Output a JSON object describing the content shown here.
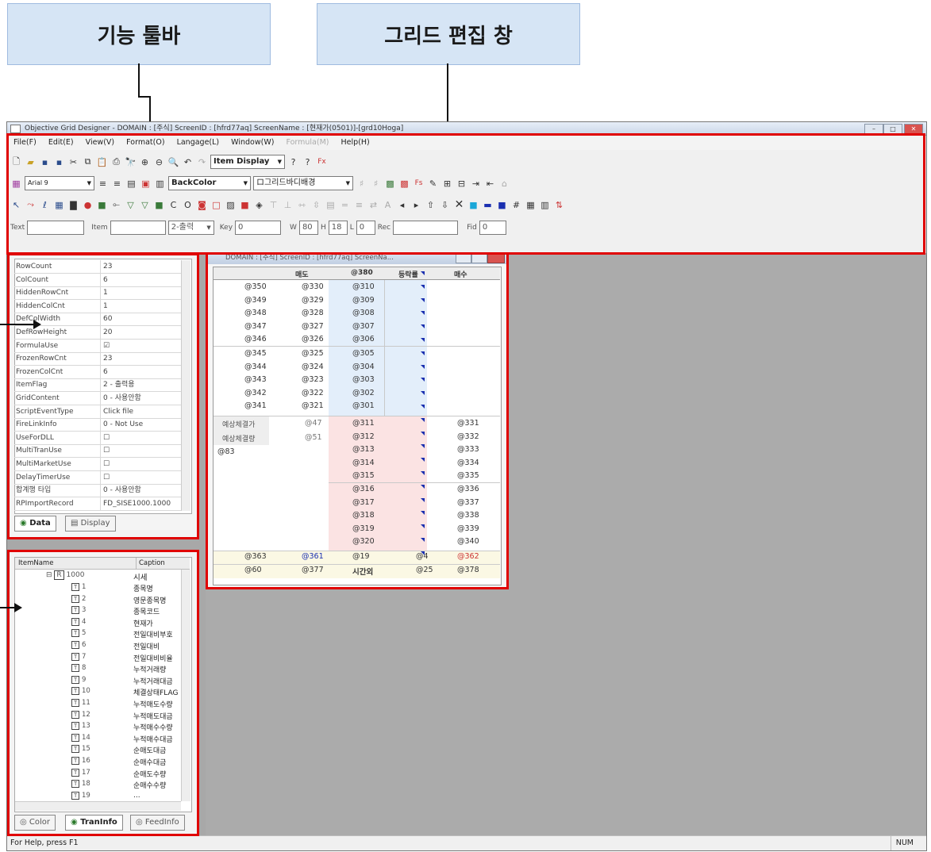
{
  "callouts": {
    "toolbar": "기능 툴바",
    "grid_edit": "그리드 편집 창"
  },
  "app": {
    "title": "Objective Grid Designer - DOMAIN : [주식]  ScreenID : [hfrd77aq]  ScreenName : [현재가(0501)]-[grd10Hoga]",
    "menu": [
      "File(F)",
      "Edit(E)",
      "View(V)",
      "Format(O)",
      "Langage(L)",
      "Window(W)",
      "Formula(M)",
      "Help(H)"
    ],
    "toolbar": {
      "item_display": "Item Display",
      "font_combo": "Arial 9",
      "backcolor": "BackColor",
      "bg_combo": "ロ그리드바디배경",
      "text_label": "Text",
      "item_label": "Item",
      "output_combo": "2-출력",
      "key_label": "Key",
      "key_value": "0",
      "w_label": "W",
      "w_value": "80",
      "h_label": "H",
      "h_value": "18",
      "l_label": "L",
      "l_value": "0",
      "rec_label": "Rec",
      "fid_label": "Fid",
      "fid_value": "0"
    },
    "properties": [
      {
        "k": "RowCount",
        "v": "23"
      },
      {
        "k": "ColCount",
        "v": "6"
      },
      {
        "k": "HiddenRowCnt",
        "v": "1"
      },
      {
        "k": "HiddenColCnt",
        "v": "1"
      },
      {
        "k": "DefColWidth",
        "v": "60"
      },
      {
        "k": "DefRowHeight",
        "v": "20"
      },
      {
        "k": "FormulaUse",
        "v": "☑"
      },
      {
        "k": "FrozenRowCnt",
        "v": "23"
      },
      {
        "k": "FrozenColCnt",
        "v": "6"
      },
      {
        "k": "ItemFlag",
        "v": "2 - 출력용"
      },
      {
        "k": "GridContent",
        "v": "0 - 사용안함"
      },
      {
        "k": "ScriptEventType",
        "v": "Click file"
      },
      {
        "k": "FireLinkInfo",
        "v": "0 - Not Use"
      },
      {
        "k": "UseForDLL",
        "v": "☐"
      },
      {
        "k": "MultiTranUse",
        "v": "☐"
      },
      {
        "k": "MultiMarketUse",
        "v": "☐"
      },
      {
        "k": "DelayTimerUse",
        "v": "☐"
      },
      {
        "k": "합계행 타입",
        "v": "0 - 사용안함"
      },
      {
        "k": "RPImportRecord",
        "v": "FD_SISE1000.1000"
      }
    ],
    "prop_tabs": [
      "Data",
      "Display"
    ],
    "tree": {
      "col_item": "ItemName",
      "col_caption": "Caption",
      "root_id": "1000",
      "root_caption": "시세",
      "items": [
        {
          "id": "1",
          "caption": "종목명"
        },
        {
          "id": "2",
          "caption": "영문종목명"
        },
        {
          "id": "3",
          "caption": "종목코드"
        },
        {
          "id": "4",
          "caption": "현재가"
        },
        {
          "id": "5",
          "caption": "전일대비부호"
        },
        {
          "id": "6",
          "caption": "전일대비"
        },
        {
          "id": "7",
          "caption": "전일대비비율"
        },
        {
          "id": "8",
          "caption": "누적거래량"
        },
        {
          "id": "9",
          "caption": "누적거래대금"
        },
        {
          "id": "10",
          "caption": "체결상태FLAG"
        },
        {
          "id": "11",
          "caption": "누적매도수량"
        },
        {
          "id": "12",
          "caption": "누적매도대금"
        },
        {
          "id": "13",
          "caption": "누적매수수량"
        },
        {
          "id": "14",
          "caption": "누적매수대금"
        },
        {
          "id": "15",
          "caption": "순매도대금"
        },
        {
          "id": "16",
          "caption": "순매수대금"
        },
        {
          "id": "17",
          "caption": "순매도수량"
        },
        {
          "id": "18",
          "caption": "순매수수량"
        },
        {
          "id": "19",
          "caption": "..."
        }
      ],
      "tabs": [
        "Color",
        "TranInfo",
        "FeedInfo"
      ]
    },
    "grid_window": {
      "title": "DOMAIN : [주식]  ScreenID : [hfrd77aq]  ScreenNa...",
      "headers": [
        "",
        "매도",
        "@380",
        "등락률",
        "매수"
      ],
      "rows": [
        [
          "@350",
          "@330",
          "@310"
        ],
        [
          "@349",
          "@329",
          "@309"
        ],
        [
          "@348",
          "@328",
          "@308"
        ],
        [
          "@347",
          "@327",
          "@307"
        ],
        [
          "@346",
          "@326",
          "@306"
        ],
        [
          "@345",
          "@325",
          "@305"
        ],
        [
          "@344",
          "@324",
          "@304"
        ],
        [
          "@343",
          "@323",
          "@303"
        ],
        [
          "@342",
          "@322",
          "@302"
        ],
        [
          "@341",
          "@321",
          "@301"
        ]
      ],
      "mid_labels": [
        "예상체결가",
        "예상체결량"
      ],
      "mid_vals": [
        "@47",
        "@51"
      ],
      "mid_left": "@83",
      "center_lower": [
        "@311",
        "@312",
        "@313",
        "@314",
        "@315",
        "@316",
        "@317",
        "@318",
        "@319",
        "@320"
      ],
      "right_lower": [
        "@331",
        "@332",
        "@333",
        "@334",
        "@335",
        "@336",
        "@337",
        "@338",
        "@339",
        "@340"
      ],
      "footer1": [
        "@363",
        "@361",
        "@19",
        "@4",
        "@362"
      ],
      "footer2": [
        "@60",
        "@377",
        "시간외",
        "@25",
        "@378"
      ]
    },
    "status": {
      "help": "For Help, press F1",
      "num": "NUM"
    }
  }
}
